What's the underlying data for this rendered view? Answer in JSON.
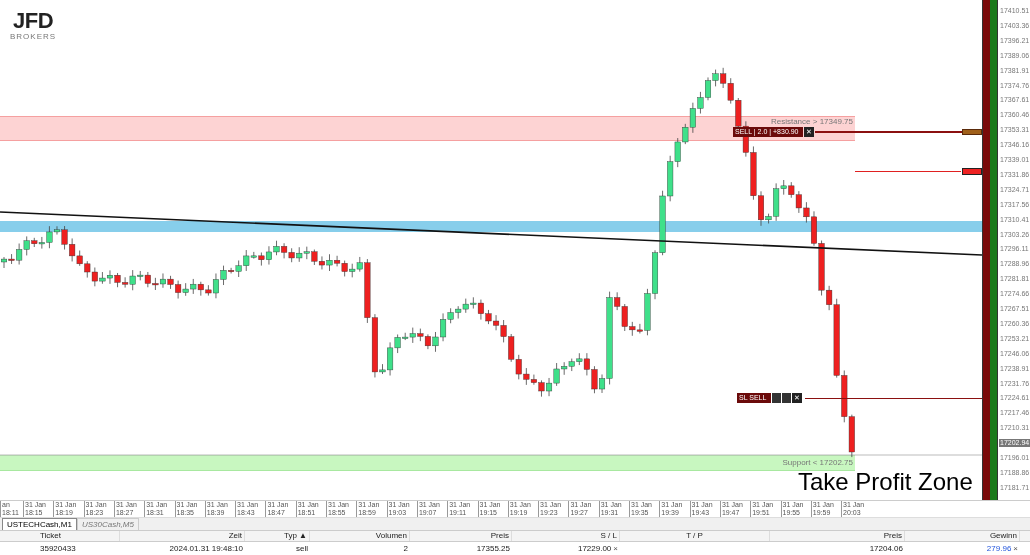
{
  "logo": {
    "name": "JFD",
    "tagline": "BROKERS"
  },
  "chart": {
    "zones": [
      {
        "kind": "resistance",
        "label": "Resistance > 17349.75"
      },
      {
        "kind": "band"
      },
      {
        "kind": "support",
        "label": "Support < 17202.75"
      }
    ],
    "orders": [
      {
        "kind": "entry",
        "label": "SELL | 2.0 | +830.90",
        "close": "✕"
      },
      {
        "kind": "takeprofit"
      },
      {
        "kind": "stoploss",
        "label": "SL SELL",
        "close": "✕"
      }
    ],
    "annotation": "Take Profit Zone",
    "price_axis": [
      {
        "text": "17410.51",
        "selected": false
      },
      {
        "text": "17403.36",
        "selected": false
      },
      {
        "text": "17396.21",
        "selected": false
      },
      {
        "text": "17389.06",
        "selected": false
      },
      {
        "text": "17381.91",
        "selected": false
      },
      {
        "text": "17374.76",
        "selected": false
      },
      {
        "text": "17367.61",
        "selected": false
      },
      {
        "text": "17360.46",
        "selected": false
      },
      {
        "text": "17353.31",
        "selected": false
      },
      {
        "text": "17346.16",
        "selected": false
      },
      {
        "text": "17339.01",
        "selected": false
      },
      {
        "text": "17331.86",
        "selected": false
      },
      {
        "text": "17324.71",
        "selected": false
      },
      {
        "text": "17317.56",
        "selected": false
      },
      {
        "text": "17310.41",
        "selected": false
      },
      {
        "text": "17303.26",
        "selected": false
      },
      {
        "text": "17296.11",
        "selected": false
      },
      {
        "text": "17288.96",
        "selected": false
      },
      {
        "text": "17281.81",
        "selected": false
      },
      {
        "text": "17274.66",
        "selected": false
      },
      {
        "text": "17267.51",
        "selected": false
      },
      {
        "text": "17260.36",
        "selected": false
      },
      {
        "text": "17253.21",
        "selected": false
      },
      {
        "text": "17246.06",
        "selected": false
      },
      {
        "text": "17238.91",
        "selected": false
      },
      {
        "text": "17231.76",
        "selected": false
      },
      {
        "text": "17224.61",
        "selected": false
      },
      {
        "text": "17217.46",
        "selected": false
      },
      {
        "text": "17210.31",
        "selected": false
      },
      {
        "text": "17202.94",
        "selected": true
      },
      {
        "text": "17196.01",
        "selected": false
      },
      {
        "text": "17188.86",
        "selected": false
      },
      {
        "text": "17181.71",
        "selected": false
      }
    ],
    "time_axis": [
      "an 18:11",
      "31 Jan 18:15",
      "31 Jan 18:19",
      "31 Jan 18:23",
      "31 Jan 18:27",
      "31 Jan 18:31",
      "31 Jan 18:35",
      "31 Jan 18:39",
      "31 Jan 18:43",
      "31 Jan 18:47",
      "31 Jan 18:51",
      "31 Jan 18:55",
      "31 Jan 18:59",
      "31 Jan 19:03",
      "31 Jan 19:07",
      "31 Jan 19:11",
      "31 Jan 19:15",
      "31 Jan 19:19",
      "31 Jan 19:23",
      "31 Jan 19:27",
      "31 Jan 19:31",
      "31 Jan 19:35",
      "31 Jan 19:39",
      "31 Jan 19:43",
      "31 Jan 19:47",
      "31 Jan 19:51",
      "31 Jan 19:55",
      "31 Jan 19:59",
      "31 Jan 20:03"
    ]
  },
  "tabs": [
    {
      "label": "USTECHCash,M1",
      "selected": true
    },
    {
      "label": "US30Cash,M5",
      "selected": false
    }
  ],
  "table": {
    "columns": [
      "Ticket",
      "Zeit",
      "Typ ▲",
      "Volumen",
      "Preis",
      "S / L",
      "T / P",
      "Preis",
      "Gewinn"
    ],
    "rows": [
      {
        "cells": [
          {
            "text": "35920433"
          },
          {
            "text": "2024.01.31 19:48:10"
          },
          {
            "text": "sell"
          },
          {
            "text": "2"
          },
          {
            "text": "17355.25"
          },
          {
            "text": "17229.00",
            "remove": "×"
          },
          {
            "text": ""
          },
          {
            "text": "17204.06"
          },
          {
            "text": "279.96",
            "remove": "×",
            "kind": "profit"
          }
        ]
      }
    ]
  }
}
